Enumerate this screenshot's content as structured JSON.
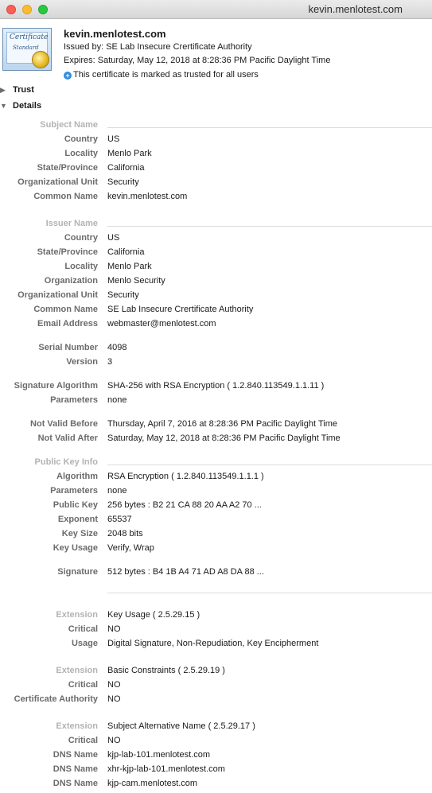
{
  "window": {
    "title": "kevin.menlotest.com"
  },
  "header": {
    "icon_word1": "Certificate",
    "icon_word2": "Standard",
    "title": "kevin.menlotest.com",
    "issued_by": "Issued by: SE Lab Insecure Crertificate Authority",
    "expires": "Expires: Saturday, May 12, 2018 at 8:28:36 PM Pacific Daylight Time",
    "trusted": "This certificate is marked as trusted for all users"
  },
  "sections": {
    "trust": "Trust",
    "details": "Details"
  },
  "subject": {
    "heading": "Subject Name",
    "country": {
      "label": "Country",
      "value": "US"
    },
    "locality": {
      "label": "Locality",
      "value": "Menlo Park"
    },
    "state": {
      "label": "State/Province",
      "value": "California"
    },
    "org_unit": {
      "label": "Organizational Unit",
      "value": "Security"
    },
    "common_name": {
      "label": "Common Name",
      "value": "kevin.menlotest.com"
    }
  },
  "issuer": {
    "heading": "Issuer Name",
    "country": {
      "label": "Country",
      "value": "US"
    },
    "state": {
      "label": "State/Province",
      "value": "California"
    },
    "locality": {
      "label": "Locality",
      "value": "Menlo Park"
    },
    "organization": {
      "label": "Organization",
      "value": "Menlo Security"
    },
    "org_unit": {
      "label": "Organizational Unit",
      "value": "Security"
    },
    "common_name": {
      "label": "Common Name",
      "value": "SE Lab Insecure Crertificate Authority"
    },
    "email": {
      "label": "Email Address",
      "value": "webmaster@menlotest.com"
    }
  },
  "serial": {
    "serial_number": {
      "label": "Serial Number",
      "value": "4098"
    },
    "version": {
      "label": "Version",
      "value": "3"
    }
  },
  "signature_algo": {
    "algorithm": {
      "label": "Signature Algorithm",
      "value": "SHA-256 with RSA Encryption ( 1.2.840.113549.1.1.11 )"
    },
    "parameters": {
      "label": "Parameters",
      "value": "none"
    }
  },
  "validity": {
    "not_before": {
      "label": "Not Valid Before",
      "value": "Thursday, April 7, 2016 at 8:28:36 PM Pacific Daylight Time"
    },
    "not_after": {
      "label": "Not Valid After",
      "value": "Saturday, May 12, 2018 at 8:28:36 PM Pacific Daylight Time"
    }
  },
  "public_key": {
    "heading": "Public Key Info",
    "algorithm": {
      "label": "Algorithm",
      "value": "RSA Encryption ( 1.2.840.113549.1.1.1 )"
    },
    "parameters": {
      "label": "Parameters",
      "value": "none"
    },
    "key": {
      "label": "Public Key",
      "value": "256 bytes : B2 21 CA 88 20 AA A2 70 ..."
    },
    "exponent": {
      "label": "Exponent",
      "value": "65537"
    },
    "key_size": {
      "label": "Key Size",
      "value": "2048 bits"
    },
    "key_usage": {
      "label": "Key Usage",
      "value": "Verify, Wrap"
    },
    "signature": {
      "label": "Signature",
      "value": "512 bytes : B4 1B A4 71 AD A8 DA 88 ..."
    }
  },
  "ext_key_usage": {
    "extension": {
      "label": "Extension",
      "value": "Key Usage ( 2.5.29.15 )"
    },
    "critical": {
      "label": "Critical",
      "value": "NO"
    },
    "usage": {
      "label": "Usage",
      "value": "Digital Signature, Non-Repudiation, Key Encipherment"
    }
  },
  "ext_basic": {
    "extension": {
      "label": "Extension",
      "value": "Basic Constraints ( 2.5.29.19 )"
    },
    "critical": {
      "label": "Critical",
      "value": "NO"
    },
    "ca": {
      "label": "Certificate Authority",
      "value": "NO"
    }
  },
  "ext_san": {
    "extension": {
      "label": "Extension",
      "value": "Subject Alternative Name ( 2.5.29.17 )"
    },
    "critical": {
      "label": "Critical",
      "value": "NO"
    },
    "dns1": {
      "label": "DNS Name",
      "value": "kjp-lab-101.menlotest.com"
    },
    "dns2": {
      "label": "DNS Name",
      "value": "xhr-kjp-lab-101.menlotest.com"
    },
    "dns3": {
      "label": "DNS Name",
      "value": "kjp-cam.menlotest.com"
    }
  }
}
